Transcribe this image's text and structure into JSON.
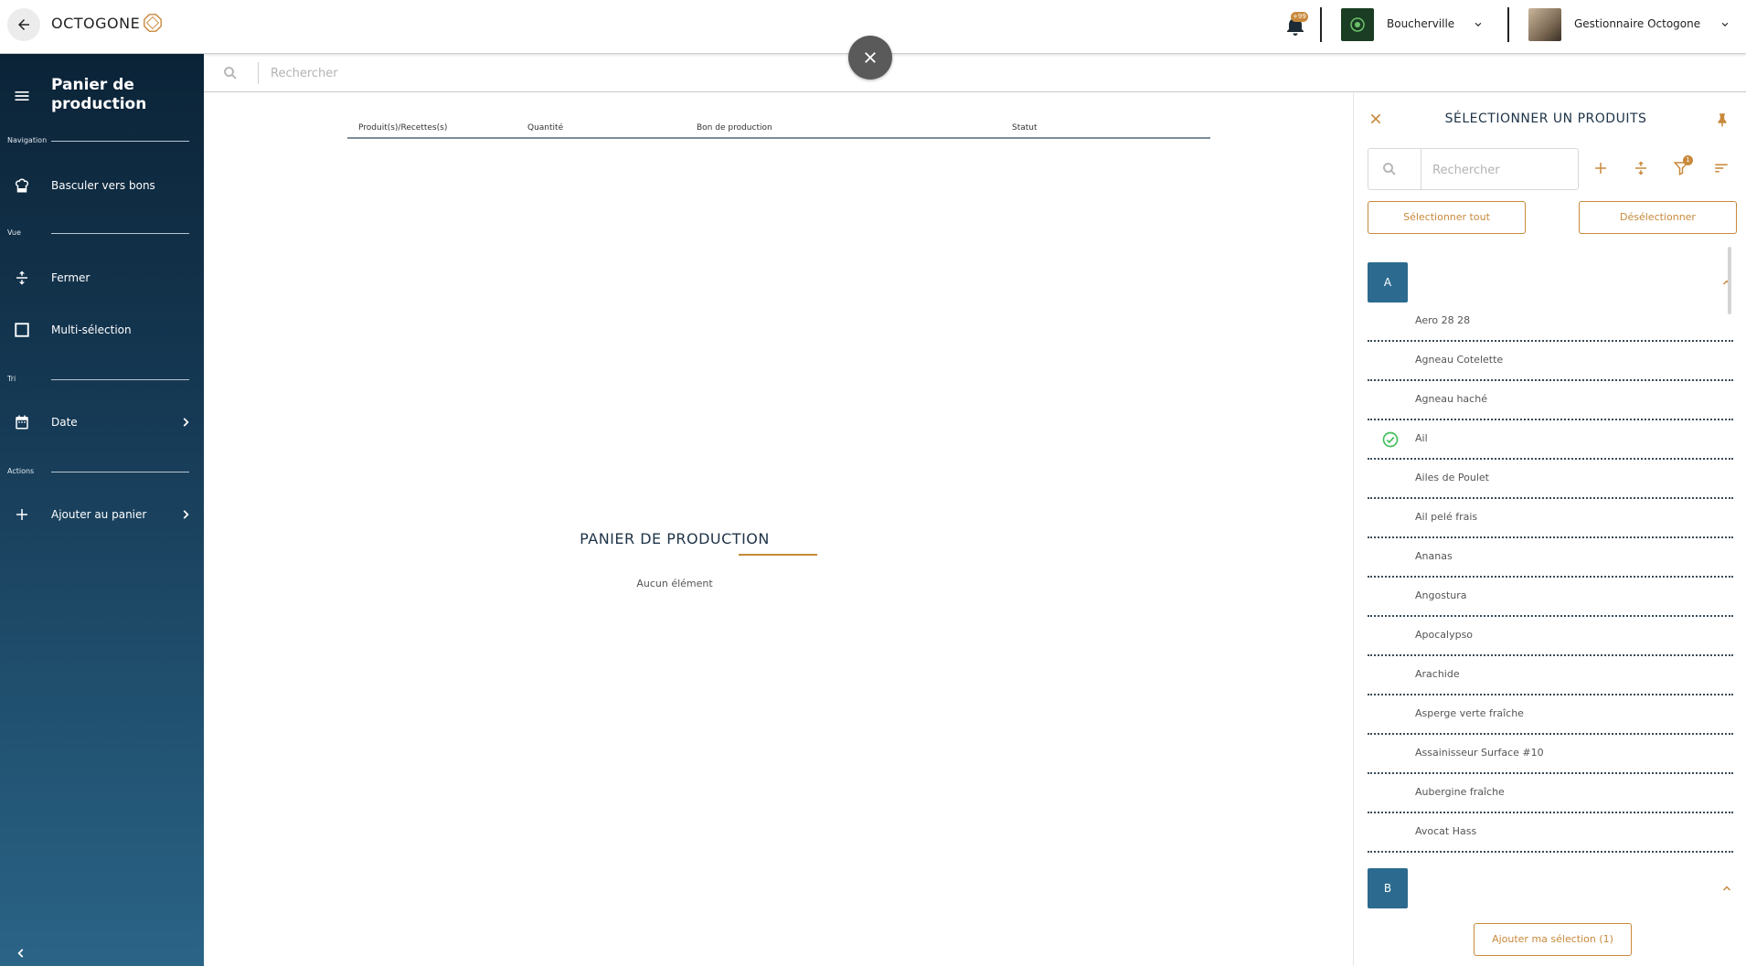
{
  "app": {
    "brand": "OCTOGONE",
    "notifications_badge": "+99",
    "location": "Boucherville",
    "user": "Gestionnaire Octogone",
    "accent": "#c8893b",
    "navy": "#0b2337"
  },
  "sidebar": {
    "title": "Panier de production",
    "sections": {
      "navigation": "Navigation",
      "vue": "Vue",
      "tri": "Tri",
      "actions": "Actions"
    },
    "items": [
      {
        "label": "Basculer vers bons",
        "icon": "chef-hat-icon"
      },
      {
        "label": "Fermer",
        "icon": "collapse-vertical-icon"
      },
      {
        "label": "Multi-sélection",
        "icon": "checkbox-icon"
      },
      {
        "label": "Date",
        "icon": "calendar-icon"
      },
      {
        "label": "Ajouter au panier",
        "icon": "plus-icon"
      }
    ]
  },
  "main": {
    "search_placeholder": "Rechercher",
    "columns": [
      "Produit(s)/Recettes(s)",
      "Quantité",
      "Bon de production",
      "Statut"
    ],
    "empty_title": "PANIER DE PRODUCTION",
    "empty_subtitle": "Aucun élément"
  },
  "panel": {
    "title": "SÉLECTIONNER UN PRODUITS",
    "search_placeholder": "Rechercher",
    "filter_badge": "1",
    "select_all": "Sélectionner tout",
    "deselect": "Désélectionner",
    "groups": [
      {
        "letter": "A",
        "items": [
          {
            "name": "Aero 28 28",
            "selected": false
          },
          {
            "name": "Agneau Cotelette",
            "selected": false
          },
          {
            "name": "Agneau haché",
            "selected": false
          },
          {
            "name": "Ail",
            "selected": true
          },
          {
            "name": "Ailes de Poulet",
            "selected": false
          },
          {
            "name": "Ail pelé frais",
            "selected": false
          },
          {
            "name": "Ananas",
            "selected": false
          },
          {
            "name": "Angostura",
            "selected": false
          },
          {
            "name": "Apocalypso",
            "selected": false
          },
          {
            "name": "Arachide",
            "selected": false
          },
          {
            "name": "Asperge verte fraîche",
            "selected": false
          },
          {
            "name": "Assainisseur Surface #10",
            "selected": false
          },
          {
            "name": "Aubergine fraîche",
            "selected": false
          },
          {
            "name": "Avocat Hass",
            "selected": false
          }
        ]
      },
      {
        "letter": "B",
        "items": []
      }
    ],
    "add_selection": "Ajouter ma sélection (1)"
  }
}
